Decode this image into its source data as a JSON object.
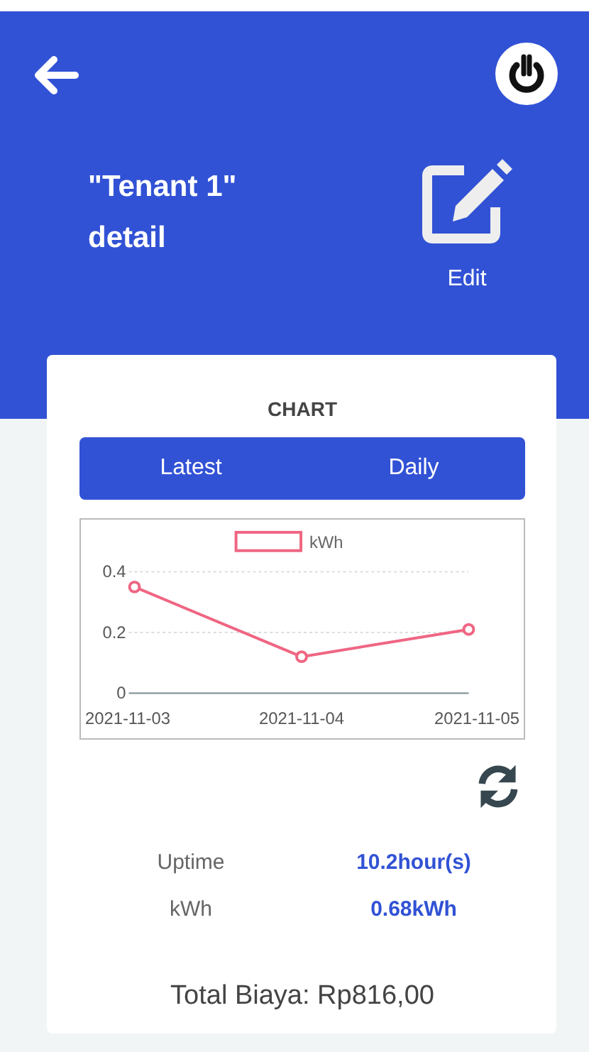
{
  "header": {
    "title": "\"Tenant 1\" detail",
    "edit_label": "Edit"
  },
  "card": {
    "heading": "CHART",
    "tabs": [
      {
        "label": "Latest"
      },
      {
        "label": "Daily"
      }
    ],
    "chart_data": {
      "type": "line",
      "categories": [
        "2021-11-03",
        "2021-11-04",
        "2021-11-05"
      ],
      "series": [
        {
          "name": "kWh",
          "color": "#ef6682",
          "marker": "circle",
          "values": [
            0.35,
            0.12,
            0.21
          ]
        }
      ],
      "ylim": [
        0,
        0.4
      ],
      "yticks": [
        0,
        0.2,
        0.4
      ]
    },
    "stats": [
      {
        "label": "Uptime",
        "value": "10.2hour(s)"
      },
      {
        "label": "kWh",
        "value": "0.68kWh"
      }
    ],
    "total": "Total Biaya: Rp816,00"
  }
}
